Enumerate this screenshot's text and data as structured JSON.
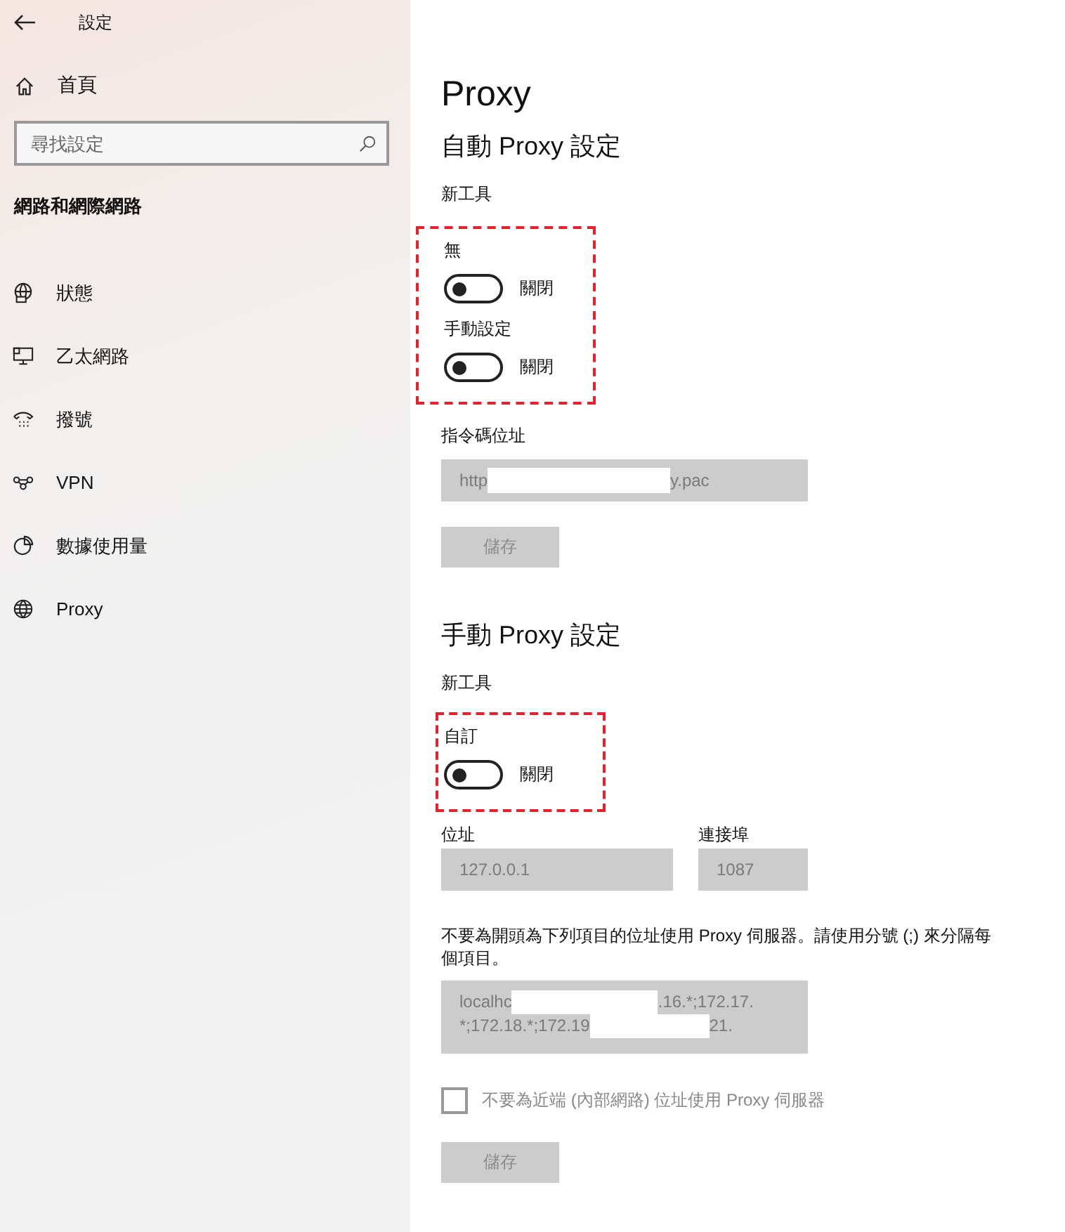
{
  "window": {
    "title": "設定"
  },
  "sidebar": {
    "home": "首頁",
    "search": {
      "placeholder": "尋找設定"
    },
    "section": "網路和網際網路",
    "items": [
      {
        "label": "狀態"
      },
      {
        "label": "乙太網路"
      },
      {
        "label": "撥號"
      },
      {
        "label": "VPN"
      },
      {
        "label": "數據使用量"
      },
      {
        "label": "Proxy"
      }
    ]
  },
  "page": {
    "title": "Proxy",
    "auto": {
      "heading": "自動 Proxy 設定",
      "subheading": "新工具",
      "highlighted": true,
      "toggles": [
        {
          "label": "無",
          "on": false,
          "state": "關閉"
        },
        {
          "label": "手動設定",
          "on": false,
          "state": "關閉"
        }
      ],
      "script_address": {
        "label": "指令碼位址",
        "value_parts": [
          "http",
          "y.pac"
        ],
        "redacted": true,
        "disabled": true
      },
      "save": {
        "label": "儲存",
        "disabled": true
      }
    },
    "manual": {
      "heading": "手動 Proxy 設定",
      "subheading": "新工具",
      "highlighted": true,
      "toggle": {
        "label": "自訂",
        "on": false,
        "state": "關閉"
      },
      "address": {
        "label": "位址",
        "value": "127.0.0.1",
        "disabled": true
      },
      "port": {
        "label": "連接埠",
        "value": "1087",
        "disabled": true
      },
      "exceptions_note": "不要為開頭為下列項目的位址使用 Proxy 伺服器。請使用分號 (;) 來分隔每個項目。",
      "exceptions": {
        "lines": [
          [
            "localhc",
            ".16.*;172.17."
          ],
          [
            "*;172.18.*;172.19",
            "21."
          ]
        ],
        "redacted": true,
        "disabled": true
      },
      "bypass_local": {
        "label": "不要為近端 (內部網路) 位址使用 Proxy 伺服器",
        "checked": false,
        "disabled": true
      },
      "save": {
        "label": "儲存",
        "disabled": true
      }
    }
  }
}
